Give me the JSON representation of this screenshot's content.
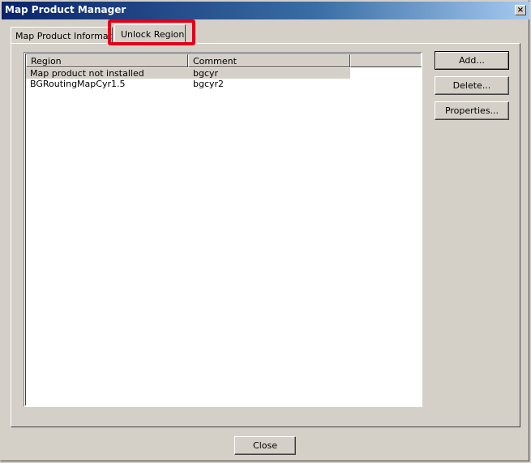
{
  "window": {
    "title": "Map Product Manager",
    "close_glyph": "×"
  },
  "tabs": [
    {
      "label": "Map Product Information"
    },
    {
      "label": "Unlock Regions"
    }
  ],
  "listview": {
    "columns": [
      "Region",
      "Comment",
      ""
    ],
    "rows": [
      {
        "region": "Map product not installed",
        "comment": "bgcyr"
      },
      {
        "region": "BGRoutingMapCyr1.5",
        "comment": "bgcyr2"
      }
    ]
  },
  "buttons": {
    "add": "Add...",
    "delete": "Delete...",
    "properties": "Properties...",
    "close": "Close"
  },
  "colors": {
    "highlight": "#e0001a",
    "titlebar_start": "#0a246a",
    "titlebar_end": "#a6caf0"
  }
}
